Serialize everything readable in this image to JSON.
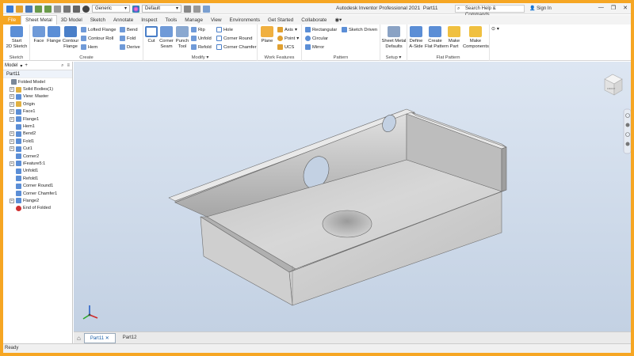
{
  "app": {
    "title": "Autodesk Inventor Professional 2021",
    "document": "Part11"
  },
  "qat": {
    "material": "Generic",
    "appearance": "Default"
  },
  "search": {
    "placeholder": "Search Help & Commands..."
  },
  "account": {
    "signin": "Sign In"
  },
  "tabs": [
    "File",
    "Sheet Metal",
    "3D Model",
    "Sketch",
    "Annotate",
    "Inspect",
    "Tools",
    "Manage",
    "View",
    "Environments",
    "Get Started",
    "Collaborate"
  ],
  "ribbon": {
    "sketch": {
      "title": "Sketch",
      "start": "Start\n2D Sketch"
    },
    "create": {
      "title": "Create",
      "face": "Face",
      "flange": "Flange",
      "contour_flange": "Contour\nFlange",
      "lofted_flange": "Lofted Flange",
      "contour_roll": "Contour Roll",
      "hem": "Hem",
      "bend": "Bend",
      "fold": "Fold",
      "derive": "Derive"
    },
    "modify": {
      "title": "Modify",
      "cut": "Cut",
      "corner_seam": "Corner\nSeam",
      "punch_tool": "Punch\nTool",
      "rip": "Rip",
      "unfold": "Unfold",
      "refold": "Refold",
      "hole": "Hole",
      "corner_round": "Corner Round",
      "corner_chamfer": "Corner Chamfer"
    },
    "work_features": {
      "title": "Work Features",
      "plane": "Plane",
      "axis": "Axis",
      "point": "Point",
      "ucs": "UCS"
    },
    "pattern": {
      "title": "Pattern",
      "rectangular": "Rectangular",
      "circular": "Circular",
      "mirror": "Mirror",
      "sketch_driven": "Sketch Driven"
    },
    "setup": {
      "title": "Setup",
      "defaults": "Sheet Metal\nDefaults"
    },
    "flat_pattern": {
      "title": "Flat Pattern",
      "define_a_side": "Define\nA-Side",
      "create_flat": "Create\nFlat Pattern",
      "make_part": "Make\nPart",
      "make_components": "Make\nComponents"
    }
  },
  "browser": {
    "header": "Model",
    "part": "Part11",
    "items": [
      {
        "label": "Folded Model",
        "exp": "",
        "color": "#7a8899"
      },
      {
        "label": "Solid Bodies(1)",
        "exp": "+",
        "color": "#e0b040"
      },
      {
        "label": "View: Master",
        "exp": "+",
        "color": "#5b8ed6"
      },
      {
        "label": "Origin",
        "exp": "+",
        "color": "#e0b040"
      },
      {
        "label": "Face1",
        "exp": "+",
        "color": "#5b8ed6"
      },
      {
        "label": "Flange1",
        "exp": "+",
        "color": "#5b8ed6"
      },
      {
        "label": "Hem1",
        "exp": "",
        "color": "#5b8ed6"
      },
      {
        "label": "Bend2",
        "exp": "+",
        "color": "#5b8ed6"
      },
      {
        "label": "Fold1",
        "exp": "+",
        "color": "#5b8ed6"
      },
      {
        "label": "Cut1",
        "exp": "+",
        "color": "#5b8ed6"
      },
      {
        "label": "Corner2",
        "exp": "",
        "color": "#5b8ed6"
      },
      {
        "label": "iFeature5:1",
        "exp": "+",
        "color": "#5b8ed6"
      },
      {
        "label": "Unfold1",
        "exp": "",
        "color": "#5b8ed6"
      },
      {
        "label": "Refold1",
        "exp": "",
        "color": "#5b8ed6"
      },
      {
        "label": "Corner Round1",
        "exp": "",
        "color": "#5b8ed6"
      },
      {
        "label": "Corner Chamfer1",
        "exp": "",
        "color": "#5b8ed6"
      },
      {
        "label": "Flange2",
        "exp": "+",
        "color": "#5b8ed6"
      },
      {
        "label": "End of Folded",
        "exp": "",
        "color": "#d03030"
      }
    ]
  },
  "viewcube": {
    "label": "FRONT"
  },
  "doc_tabs": [
    "Part11",
    "Part12"
  ],
  "status": "Ready",
  "colors": {
    "accent": "#f5a623",
    "selection": "#1a5fa8"
  }
}
